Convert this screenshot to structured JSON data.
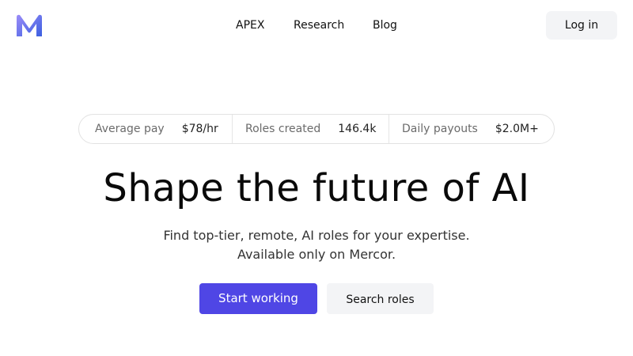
{
  "header": {
    "logo_icon": "mercor-m-logo-icon",
    "nav": [
      {
        "label": "APEX"
      },
      {
        "label": "Research"
      },
      {
        "label": "Blog"
      }
    ],
    "login_label": "Log in"
  },
  "stats": [
    {
      "label": "Average pay",
      "value": "$78/hr"
    },
    {
      "label": "Roles created",
      "value": "146.4k"
    },
    {
      "label": "Daily payouts",
      "value": "$2.0M+"
    }
  ],
  "hero": {
    "title": "Shape the future of AI",
    "subtitle_line1": "Find top-tier, remote, AI roles for your expertise.",
    "subtitle_line2": "Available only on Mercor."
  },
  "cta": {
    "primary_label": "Start working",
    "secondary_label": "Search roles"
  },
  "colors": {
    "accent": "#4f46e5",
    "logo_gradient_start": "#8b7cf6",
    "logo_gradient_end": "#3b5fe0",
    "button_secondary_bg": "#f3f4f6"
  }
}
